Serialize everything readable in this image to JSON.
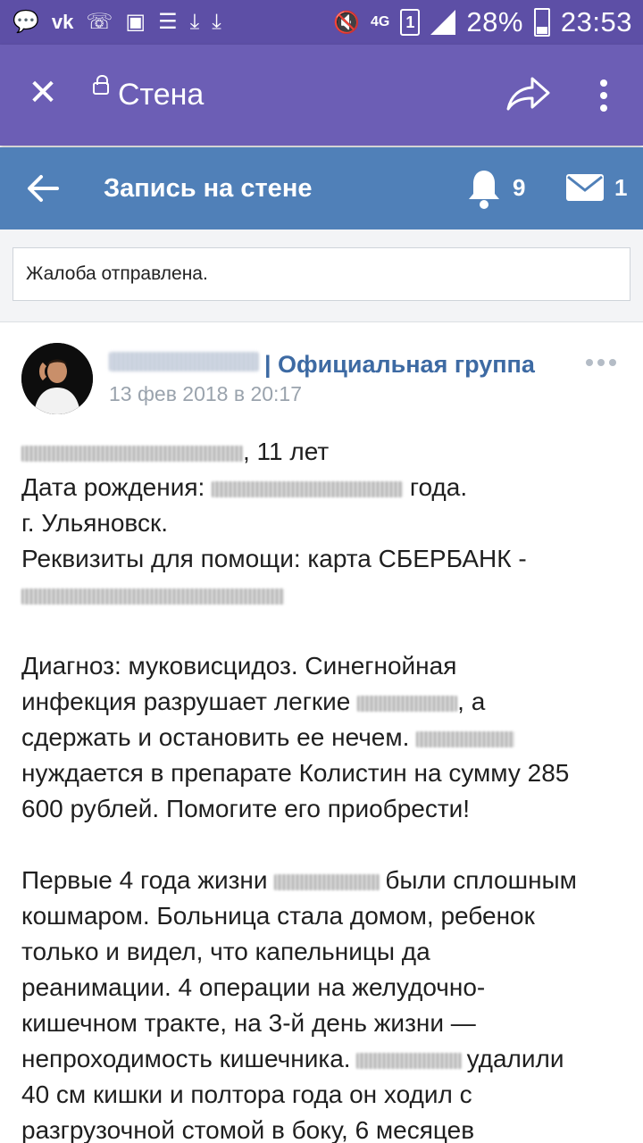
{
  "status_bar": {
    "network": "4G",
    "sim": "1",
    "battery": "28%",
    "time": "23:53",
    "icons": [
      "message-icon",
      "vk-icon",
      "viber-icon",
      "image-icon",
      "storage-icon",
      "download-icon",
      "download-icon",
      "mute-icon"
    ]
  },
  "app_bar": {
    "title": "Стена",
    "icons": [
      "close-icon",
      "lock-icon",
      "share-icon",
      "more-vertical-icon"
    ]
  },
  "vk_bar": {
    "title": "Запись на стене",
    "notifications_count": "9",
    "messages_count": "1"
  },
  "notice": "Жалоба отправлена.",
  "post": {
    "author_suffix": "| Официальная группа",
    "date": "13 фев 2018 в 20:17",
    "lines": {
      "l1": ", 11 лет",
      "l2a": "Дата рождения: ",
      "l2b": " года.",
      "l3": "г. Ульяновск.",
      "l4": "Реквизиты для помощи: карта СБЕРБАНК -",
      "l6": "Диагноз: муковисцидоз. Синегнойная",
      "l7a": "инфекция разрушает легкие ",
      "l7b": ", а",
      "l8": "сдержать и остановить ее нечем. ",
      "l9": "нуждается в препарате Колистин на сумму 285",
      "l10": "600 рублей. Помогите его приобрести!",
      "l12a": "Первые 4 года жизни ",
      "l12b": "были сплошным",
      "l13": "кошмаром. Больница стала домом, ребенок",
      "l14": "только и видел, что капельницы да",
      "l15": "реанимации. 4 операции на желудочно-",
      "l16": "кишечном тракте, на 3-й день жизни —",
      "l17a": "непроходимость кишечника.",
      "l17b": "удалили",
      "l18": "40 см кишки и полтора года он ходил с",
      "l19": "разгрузочной стомой в боку, 6 месяцев"
    }
  }
}
